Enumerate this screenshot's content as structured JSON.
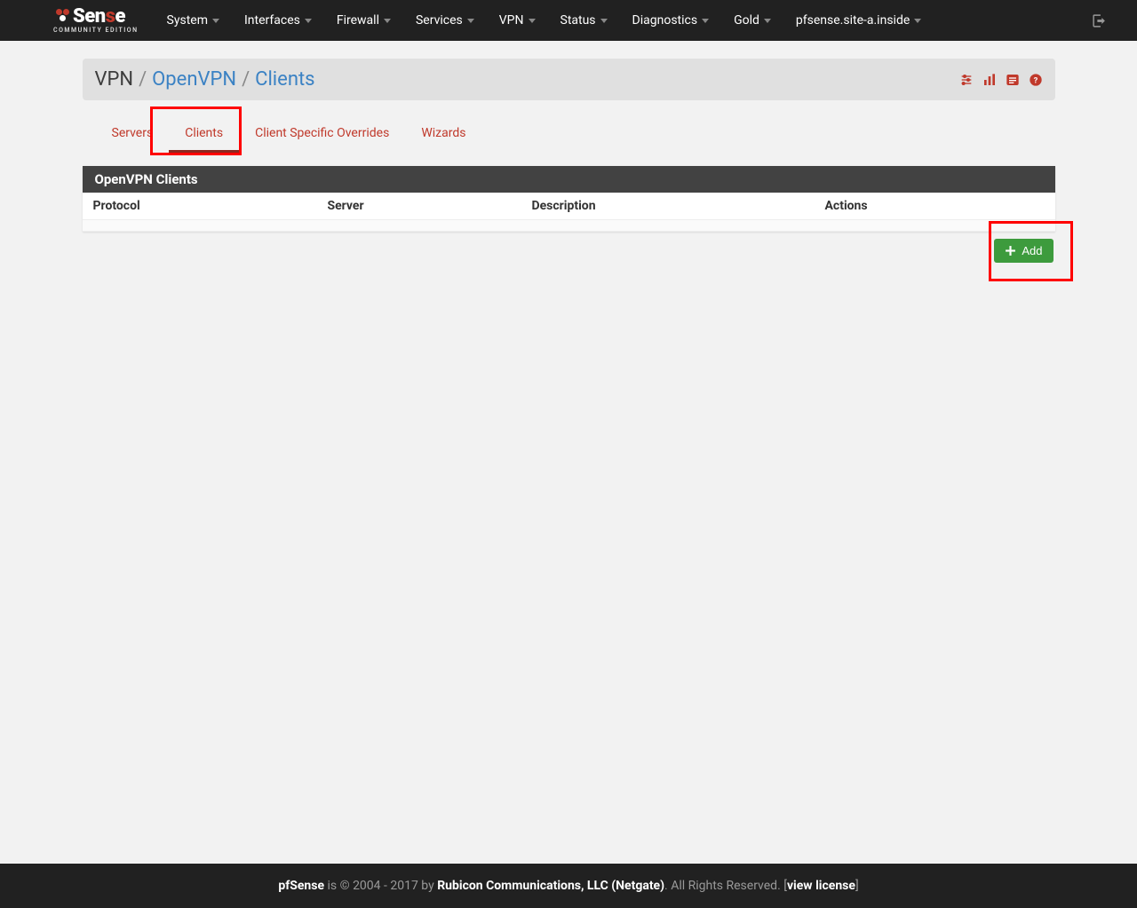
{
  "logo": {
    "main": "Sen",
    "red": "s",
    "end": "e",
    "sub": "COMMUNITY EDITION"
  },
  "nav": [
    "System",
    "Interfaces",
    "Firewall",
    "Services",
    "VPN",
    "Status",
    "Diagnostics",
    "Gold",
    "pfsense.site-a.inside"
  ],
  "breadcrumb": {
    "root": "VPN",
    "link1": "OpenVPN",
    "link2": "Clients"
  },
  "tabs": [
    "Servers",
    "Clients",
    "Client Specific Overrides",
    "Wizards"
  ],
  "active_tab": 1,
  "panel": {
    "title": "OpenVPN Clients"
  },
  "columns": {
    "protocol": "Protocol",
    "server": "Server",
    "description": "Description",
    "actions": "Actions"
  },
  "buttons": {
    "add": "Add"
  },
  "footer": {
    "brand": "pfSense",
    "mid1": " is © 2004 - 2017 by ",
    "company": "Rubicon Communications, LLC (Netgate)",
    "mid2": ". All Rights Reserved. [",
    "link": "view license",
    "end": "]"
  }
}
